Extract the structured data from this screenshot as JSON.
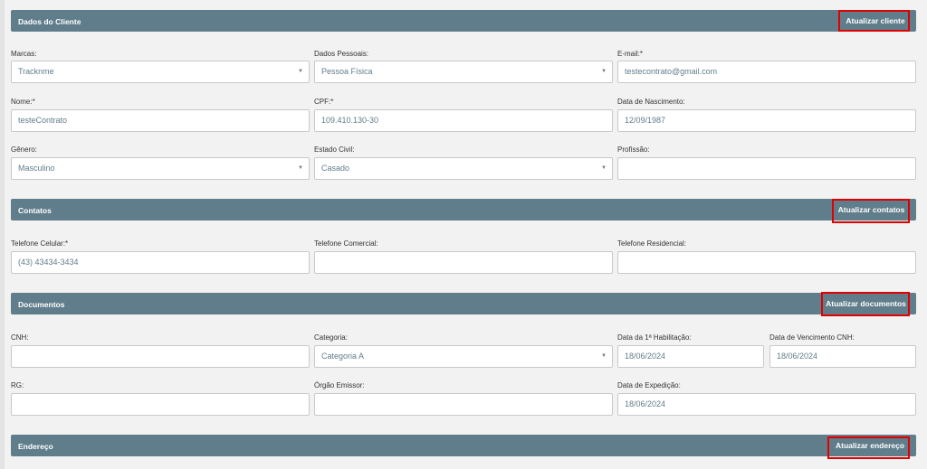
{
  "sections": {
    "cliente": {
      "title": "Dados do Cliente",
      "button": "Atualizar cliente"
    },
    "contatos": {
      "title": "Contatos",
      "button": "Atualizar contatos"
    },
    "documentos": {
      "title": "Documentos",
      "button": "Atualizar documentos"
    },
    "endereco": {
      "title": "Endereço",
      "button": "Atualizar endereço"
    }
  },
  "cliente": {
    "marcas": {
      "label": "Marcas:",
      "value": "Tracknme"
    },
    "dados_pessoais": {
      "label": "Dados Pessoais:",
      "value": "Pessoa Física"
    },
    "email": {
      "label": "E-mail:*",
      "value": "testecontrato@gmail.com"
    },
    "nome": {
      "label": "Nome:*",
      "value": "testeContrato"
    },
    "cpf": {
      "label": "CPF:*",
      "value": "109.410.130-30"
    },
    "nascimento": {
      "label": "Data de Nascimento:",
      "value": "12/09/1987"
    },
    "genero": {
      "label": "Gênero:",
      "value": "Masculino"
    },
    "estado_civil": {
      "label": "Estado Civil:",
      "value": "Casado"
    },
    "profissao": {
      "label": "Profissão:",
      "value": ""
    }
  },
  "contatos": {
    "celular": {
      "label": "Telefone Celular:*",
      "value": "(43) 43434-3434"
    },
    "comercial": {
      "label": "Telefone Comercial:",
      "value": ""
    },
    "residencial": {
      "label": "Telefone Residencial:",
      "value": ""
    }
  },
  "documentos": {
    "cnh": {
      "label": "CNH:",
      "value": ""
    },
    "categoria": {
      "label": "Categoria:",
      "value": "Categoria A"
    },
    "habilitacao": {
      "label": "Data da 1ª Habilitação:",
      "value": "18/06/2024"
    },
    "vencimento": {
      "label": "Data de Vencimento CNH:",
      "value": "18/06/2024"
    },
    "rg": {
      "label": "RG:",
      "value": ""
    },
    "orgao": {
      "label": "Órgão Emissor:",
      "value": ""
    },
    "expedicao": {
      "label": "Data de Expedição:",
      "value": "18/06/2024"
    }
  },
  "icons": {
    "select_caret": "caret-down-icon"
  },
  "colors": {
    "section_bar": "#607d8b",
    "highlight": "#e00000",
    "field_text": "#607d8b"
  }
}
